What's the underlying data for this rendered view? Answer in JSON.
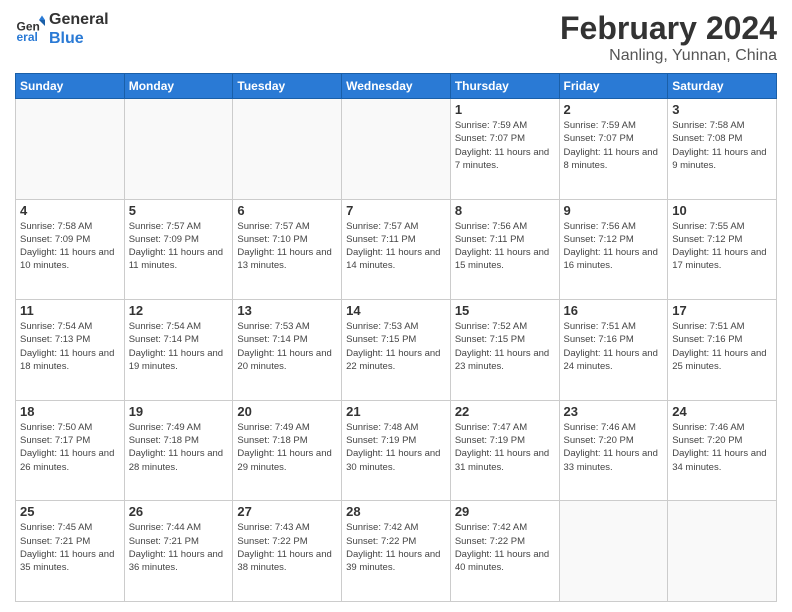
{
  "header": {
    "logo_line1": "General",
    "logo_line2": "Blue",
    "main_title": "February 2024",
    "subtitle": "Nanling, Yunnan, China"
  },
  "days_of_week": [
    "Sunday",
    "Monday",
    "Tuesday",
    "Wednesday",
    "Thursday",
    "Friday",
    "Saturday"
  ],
  "weeks": [
    [
      {
        "day": "",
        "info": ""
      },
      {
        "day": "",
        "info": ""
      },
      {
        "day": "",
        "info": ""
      },
      {
        "day": "",
        "info": ""
      },
      {
        "day": "1",
        "info": "Sunrise: 7:59 AM\nSunset: 7:07 PM\nDaylight: 11 hours and 7 minutes."
      },
      {
        "day": "2",
        "info": "Sunrise: 7:59 AM\nSunset: 7:07 PM\nDaylight: 11 hours and 8 minutes."
      },
      {
        "day": "3",
        "info": "Sunrise: 7:58 AM\nSunset: 7:08 PM\nDaylight: 11 hours and 9 minutes."
      }
    ],
    [
      {
        "day": "4",
        "info": "Sunrise: 7:58 AM\nSunset: 7:09 PM\nDaylight: 11 hours and 10 minutes."
      },
      {
        "day": "5",
        "info": "Sunrise: 7:57 AM\nSunset: 7:09 PM\nDaylight: 11 hours and 11 minutes."
      },
      {
        "day": "6",
        "info": "Sunrise: 7:57 AM\nSunset: 7:10 PM\nDaylight: 11 hours and 13 minutes."
      },
      {
        "day": "7",
        "info": "Sunrise: 7:57 AM\nSunset: 7:11 PM\nDaylight: 11 hours and 14 minutes."
      },
      {
        "day": "8",
        "info": "Sunrise: 7:56 AM\nSunset: 7:11 PM\nDaylight: 11 hours and 15 minutes."
      },
      {
        "day": "9",
        "info": "Sunrise: 7:56 AM\nSunset: 7:12 PM\nDaylight: 11 hours and 16 minutes."
      },
      {
        "day": "10",
        "info": "Sunrise: 7:55 AM\nSunset: 7:12 PM\nDaylight: 11 hours and 17 minutes."
      }
    ],
    [
      {
        "day": "11",
        "info": "Sunrise: 7:54 AM\nSunset: 7:13 PM\nDaylight: 11 hours and 18 minutes."
      },
      {
        "day": "12",
        "info": "Sunrise: 7:54 AM\nSunset: 7:14 PM\nDaylight: 11 hours and 19 minutes."
      },
      {
        "day": "13",
        "info": "Sunrise: 7:53 AM\nSunset: 7:14 PM\nDaylight: 11 hours and 20 minutes."
      },
      {
        "day": "14",
        "info": "Sunrise: 7:53 AM\nSunset: 7:15 PM\nDaylight: 11 hours and 22 minutes."
      },
      {
        "day": "15",
        "info": "Sunrise: 7:52 AM\nSunset: 7:15 PM\nDaylight: 11 hours and 23 minutes."
      },
      {
        "day": "16",
        "info": "Sunrise: 7:51 AM\nSunset: 7:16 PM\nDaylight: 11 hours and 24 minutes."
      },
      {
        "day": "17",
        "info": "Sunrise: 7:51 AM\nSunset: 7:16 PM\nDaylight: 11 hours and 25 minutes."
      }
    ],
    [
      {
        "day": "18",
        "info": "Sunrise: 7:50 AM\nSunset: 7:17 PM\nDaylight: 11 hours and 26 minutes."
      },
      {
        "day": "19",
        "info": "Sunrise: 7:49 AM\nSunset: 7:18 PM\nDaylight: 11 hours and 28 minutes."
      },
      {
        "day": "20",
        "info": "Sunrise: 7:49 AM\nSunset: 7:18 PM\nDaylight: 11 hours and 29 minutes."
      },
      {
        "day": "21",
        "info": "Sunrise: 7:48 AM\nSunset: 7:19 PM\nDaylight: 11 hours and 30 minutes."
      },
      {
        "day": "22",
        "info": "Sunrise: 7:47 AM\nSunset: 7:19 PM\nDaylight: 11 hours and 31 minutes."
      },
      {
        "day": "23",
        "info": "Sunrise: 7:46 AM\nSunset: 7:20 PM\nDaylight: 11 hours and 33 minutes."
      },
      {
        "day": "24",
        "info": "Sunrise: 7:46 AM\nSunset: 7:20 PM\nDaylight: 11 hours and 34 minutes."
      }
    ],
    [
      {
        "day": "25",
        "info": "Sunrise: 7:45 AM\nSunset: 7:21 PM\nDaylight: 11 hours and 35 minutes."
      },
      {
        "day": "26",
        "info": "Sunrise: 7:44 AM\nSunset: 7:21 PM\nDaylight: 11 hours and 36 minutes."
      },
      {
        "day": "27",
        "info": "Sunrise: 7:43 AM\nSunset: 7:22 PM\nDaylight: 11 hours and 38 minutes."
      },
      {
        "day": "28",
        "info": "Sunrise: 7:42 AM\nSunset: 7:22 PM\nDaylight: 11 hours and 39 minutes."
      },
      {
        "day": "29",
        "info": "Sunrise: 7:42 AM\nSunset: 7:22 PM\nDaylight: 11 hours and 40 minutes."
      },
      {
        "day": "",
        "info": ""
      },
      {
        "day": "",
        "info": ""
      }
    ]
  ]
}
